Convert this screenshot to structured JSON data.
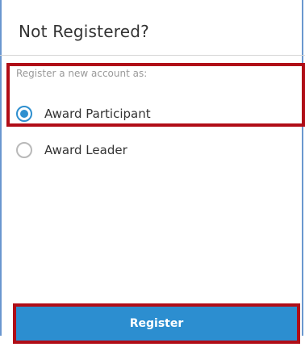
{
  "panel": {
    "title": "Not Registered?"
  },
  "registration": {
    "prompt": "Register a new account as:",
    "options": [
      {
        "label": "Award Participant",
        "checked": true
      },
      {
        "label": "Award Leader",
        "checked": false
      }
    ]
  },
  "actions": {
    "register_label": "Register"
  },
  "colors": {
    "accent": "#2e8fcf",
    "button": "#2c8ed0",
    "highlight": "#b00d17",
    "panel_border": "#6a97cf"
  }
}
